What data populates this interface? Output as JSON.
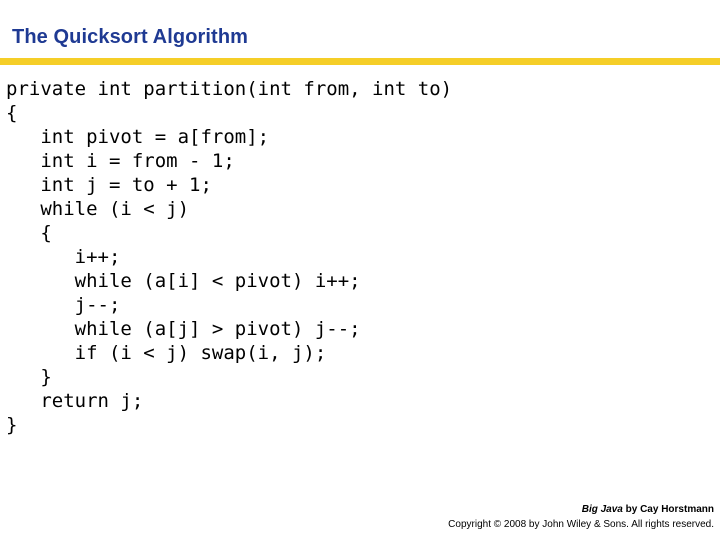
{
  "slide": {
    "title": "The Quicksort Algorithm",
    "title_color": "#1F3A93",
    "rule_color": "#F5CE28",
    "background_color": "#FFFFFF",
    "code_color": "#000000"
  },
  "code": {
    "language": "java",
    "lines": [
      "private int partition(int from, int to)",
      "{",
      "   int pivot = a[from];",
      "   int i = from - 1;",
      "   int j = to + 1;",
      "   while (i < j)",
      "   {",
      "      i++;",
      "      while (a[i] < pivot) i++;",
      "      j--;",
      "      while (a[j] > pivot) j--;",
      "      if (i < j) swap(i, j);",
      "   }",
      "   return j;",
      "}"
    ]
  },
  "footer": {
    "book_title": "Big Java",
    "credit_suffix": " by Cay Horstmann",
    "copyright": "Copyright © 2008 by John Wiley & Sons.  All rights reserved."
  }
}
